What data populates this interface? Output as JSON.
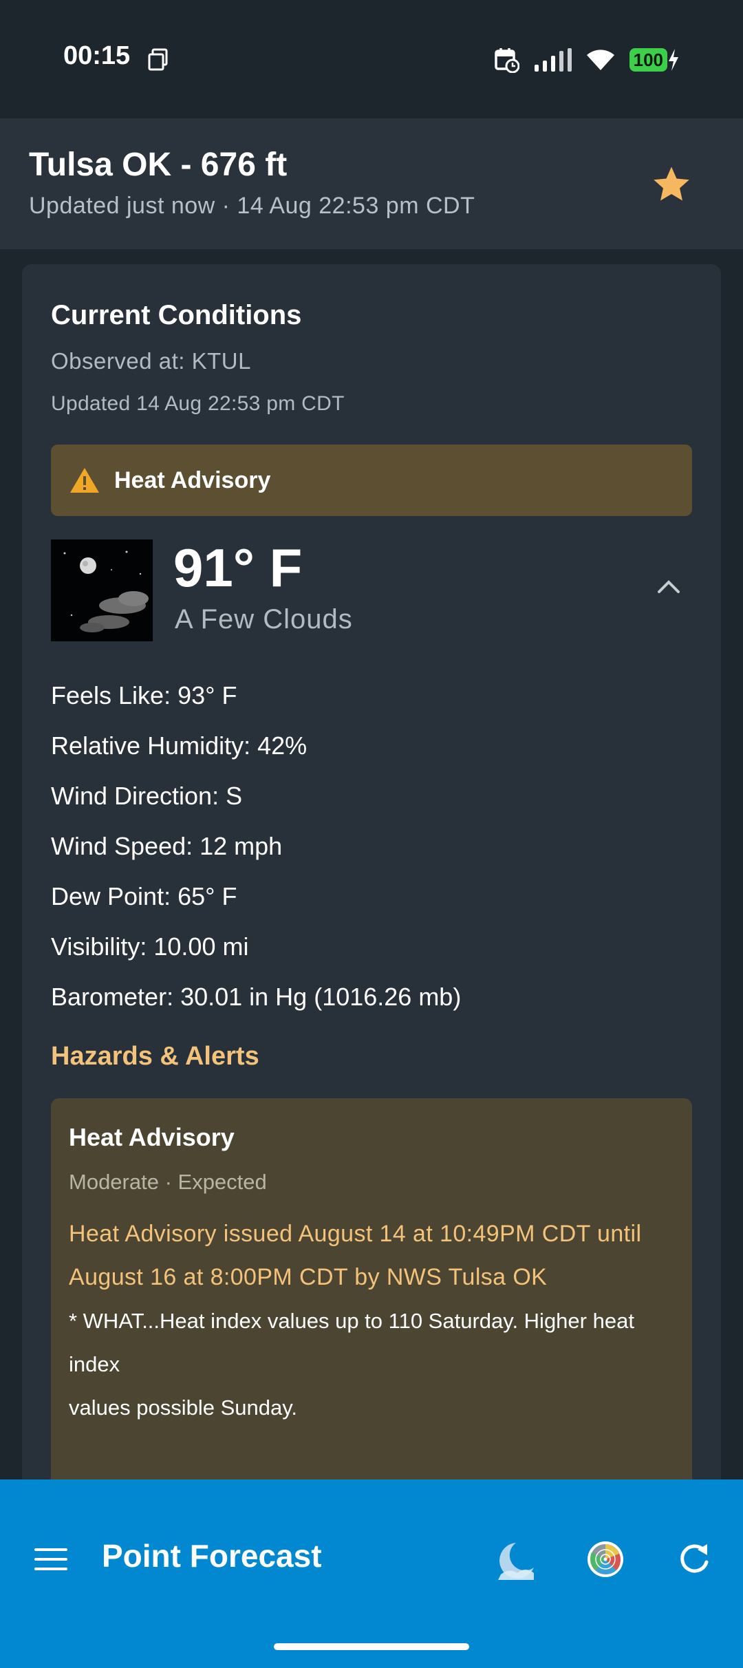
{
  "status_bar": {
    "time": "00:15",
    "battery": "100"
  },
  "header": {
    "title": "Tulsa OK - 676 ft",
    "updated": "Updated just now · 14 Aug 22:53 pm CDT"
  },
  "current": {
    "title": "Current Conditions",
    "observed": "Observed at: KTUL",
    "updated": "Updated 14 Aug 22:53 pm CDT",
    "advisory_banner": "Heat Advisory",
    "temperature": "91° F",
    "description": "A Few Clouds",
    "details": [
      "Feels Like: 93° F",
      "Relative Humidity: 42%",
      "Wind Direction: S",
      "Wind Speed: 12 mph",
      "Dew Point: 65° F",
      "Visibility: 10.00 mi",
      "Barometer: 30.01 in Hg (1016.26 mb)"
    ]
  },
  "hazards": {
    "heading": "Hazards & Alerts",
    "items": [
      {
        "title": "Heat Advisory",
        "meta": "Moderate · Expected",
        "headline": "Heat Advisory issued August 14 at 10:49PM CDT until August 16 at 8:00PM CDT by NWS Tulsa OK",
        "description_lines": [
          "* WHAT...Heat index values up to 110 Saturday. Higher heat index",
          "values possible Sunday."
        ]
      }
    ]
  },
  "bottom_bar": {
    "title": "Point Forecast"
  },
  "colors": {
    "background": "#1e262d",
    "card": "#283039",
    "advisory": "#5c4f32",
    "hazard_card": "#4b4532",
    "accent_gold": "#f3c37b",
    "app_bar": "#0288d1"
  },
  "icons": [
    "copy-icon",
    "calendar-alarm-icon",
    "signal-icon",
    "wifi-icon",
    "battery-charging-icon",
    "star-icon",
    "warning-icon",
    "chevron-up-icon",
    "menu-icon",
    "moon-icon",
    "radar-icon",
    "refresh-icon"
  ]
}
